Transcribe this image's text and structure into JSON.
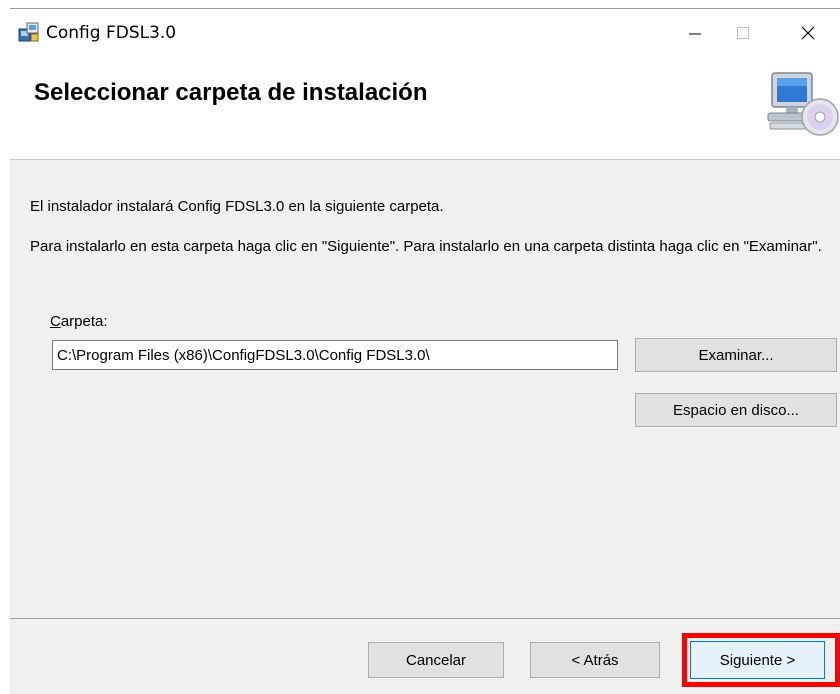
{
  "window": {
    "title": "Config FDSL3.0",
    "minimize_glyph": "—",
    "maximize_glyph": "☐",
    "close_glyph": "✕"
  },
  "header": {
    "heading": "Seleccionar carpeta de instalación",
    "icon": "computer-cd-icon"
  },
  "body": {
    "line1": "El instalador instalará Config FDSL3.0 en la siguiente carpeta.",
    "line2": "Para instalarlo en esta carpeta haga clic en \"Siguiente\". Para instalarlo en una carpeta distinta haga clic en \"Examinar\".",
    "folder_label_mnemonic": "C",
    "folder_label_rest": "arpeta:",
    "folder_path": "C:\\Program Files (x86)\\ConfigFDSL3.0\\Config FDSL3.0\\",
    "browse_button": "Examinar...",
    "disk_space_button": "Espacio en disco..."
  },
  "footer": {
    "cancel_button": "Cancelar",
    "back_button": "< Atrás",
    "next_button": "Siguiente >"
  },
  "colors": {
    "highlight": "#ff0000",
    "dialog_bg": "#f0f0f0",
    "focus_border": "#0078d7"
  }
}
